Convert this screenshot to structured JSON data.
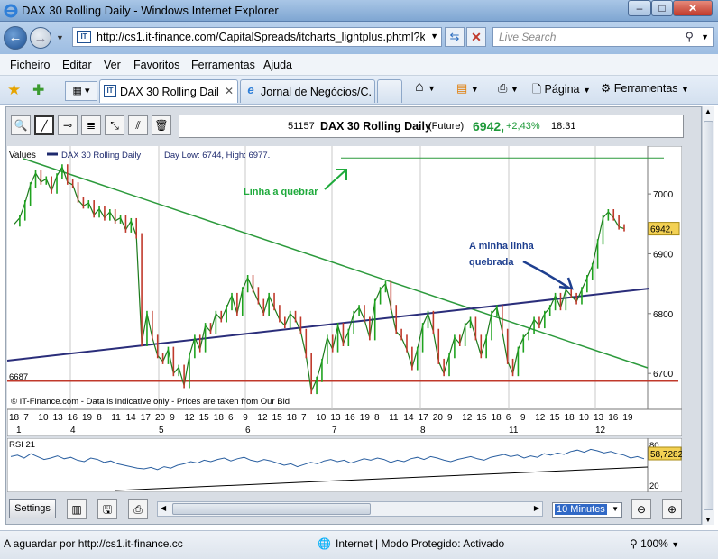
{
  "window": {
    "title": "DAX 30 Rolling Daily - Windows Internet Explorer",
    "minimize": "–",
    "maximize": "□",
    "close": "✕"
  },
  "address": {
    "url": "http://cs1.it-finance.com/CapitalSpreads/itcharts_lightplus.phtml?ke",
    "search_placeholder": "Live Search",
    "back_icon": "arrow-left-icon",
    "refresh_icon": "refresh-icon",
    "stop_icon": "stop-icon",
    "search_icon": "magnifier-icon"
  },
  "menu": {
    "items": [
      "Ficheiro",
      "Editar",
      "Ver",
      "Favoritos",
      "Ferramentas",
      "Ajuda"
    ]
  },
  "tabs": [
    {
      "label": "DAX 30 Rolling Daily",
      "icon": "IT"
    },
    {
      "label": "Jornal de Negócios/C...",
      "icon": "e"
    }
  ],
  "commands": {
    "page": "Página",
    "tools": "Ferramentas"
  },
  "info": {
    "code": "51157",
    "name": "DAX 30  Rolling Daily",
    "type": "(Future)",
    "price": "6942,",
    "change": "+2,43%",
    "time": "18:31"
  },
  "chart_data": {
    "type": "line",
    "header_label": "Values",
    "legend": "DAX 30  Rolling Daily",
    "day_stats": "Day Low: 6744, High: 6977.",
    "copyright": "© IT-Finance.com - Data is indicative only - Prices are taken from Our Bid",
    "ylim": [
      6640,
      7080
    ],
    "y_ticks": [
      7000,
      6900,
      6800,
      6700
    ],
    "y_tick_labels": [
      "7000",
      "6900",
      "6800",
      "6700"
    ],
    "last_price_label": "6942,",
    "support_label": "6687",
    "support_value": 6687,
    "resistance_value": 7060,
    "x_day_labels": [
      "18",
      "7",
      "10",
      "13",
      "16",
      "19",
      "8",
      "11",
      "14",
      "17",
      "20",
      "9",
      "12",
      "15",
      "18",
      "6",
      "9",
      "12",
      "15",
      "18",
      "7",
      "10",
      "13",
      "16",
      "19",
      "8",
      "11",
      "14",
      "17",
      "20",
      "9",
      "12",
      "15",
      "18",
      "6",
      "9",
      "12",
      "15",
      "18",
      "10",
      "13",
      "16",
      "19"
    ],
    "x_month_labels": [
      "1",
      "4",
      "5",
      "6",
      "7",
      "8",
      "11",
      "12"
    ],
    "annotations": [
      {
        "text": "Linha a quebrar",
        "color": "#1faa3c"
      },
      {
        "text": "A minha linha",
        "color": "#1e3f8f"
      },
      {
        "text": "quebrada",
        "color": "#1e3f8f"
      }
    ],
    "series": [
      {
        "values": [
          6950,
          6960,
          6985,
          7015,
          7035,
          7020,
          7025,
          7005,
          7030,
          7045,
          7020,
          7015,
          6990,
          6980,
          6985,
          6965,
          6975,
          6960,
          6970,
          6955,
          6960,
          6940,
          6955,
          6930,
          6750,
          6800,
          6760,
          6730,
          6720,
          6740,
          6700,
          6710,
          6680,
          6730,
          6760,
          6740,
          6780,
          6770,
          6800,
          6790,
          6810,
          6830,
          6800,
          6840,
          6860,
          6840,
          6820,
          6800,
          6830,
          6810,
          6790,
          6780,
          6800,
          6790,
          6770,
          6730,
          6670,
          6690,
          6720,
          6760,
          6740,
          6780,
          6750,
          6770,
          6800,
          6810,
          6790,
          6760,
          6820,
          6840,
          6850,
          6810,
          6770,
          6760,
          6740,
          6710,
          6740,
          6780,
          6800,
          6770,
          6720,
          6700,
          6730,
          6760,
          6750,
          6780,
          6790,
          6760,
          6730,
          6760,
          6800,
          6810,
          6770,
          6720,
          6700,
          6740,
          6760,
          6770,
          6790,
          6780,
          6800,
          6810,
          6830,
          6810,
          6840,
          6830,
          6820,
          6840,
          6860,
          6880,
          6920,
          6960,
          6970,
          6960,
          6945,
          6942
        ]
      }
    ],
    "rsi": {
      "label": "RSI 21",
      "last_value_label": "58,7282",
      "tick_labels": [
        "80",
        "20"
      ],
      "values": [
        62,
        64,
        60,
        66,
        62,
        58,
        60,
        63,
        59,
        61,
        57,
        55,
        60,
        58,
        54,
        56,
        52,
        50,
        48,
        46,
        45,
        47,
        44,
        48,
        46,
        50,
        52,
        55,
        53,
        57,
        55,
        58,
        60,
        56,
        59,
        61,
        57,
        55,
        58,
        56,
        53,
        50,
        52,
        48,
        51,
        54,
        52,
        56,
        58,
        55,
        57,
        53,
        56,
        59,
        57,
        60,
        58,
        54,
        57,
        55,
        59,
        61,
        58,
        62,
        60,
        57,
        55,
        58,
        60,
        62,
        59,
        57,
        61,
        63,
        65,
        62,
        64,
        60,
        63,
        61,
        66,
        64,
        67,
        65,
        69,
        71,
        68,
        72,
        70,
        67,
        69,
        66,
        64,
        60,
        62,
        59
      ]
    }
  },
  "controls": {
    "settings": "Settings",
    "interval": "10 Minutes"
  },
  "status": {
    "text": "A aguardar por http://cs1.it-finance.cc",
    "zone": "Internet | Modo Protegido: Activado",
    "zoom": "100%"
  }
}
